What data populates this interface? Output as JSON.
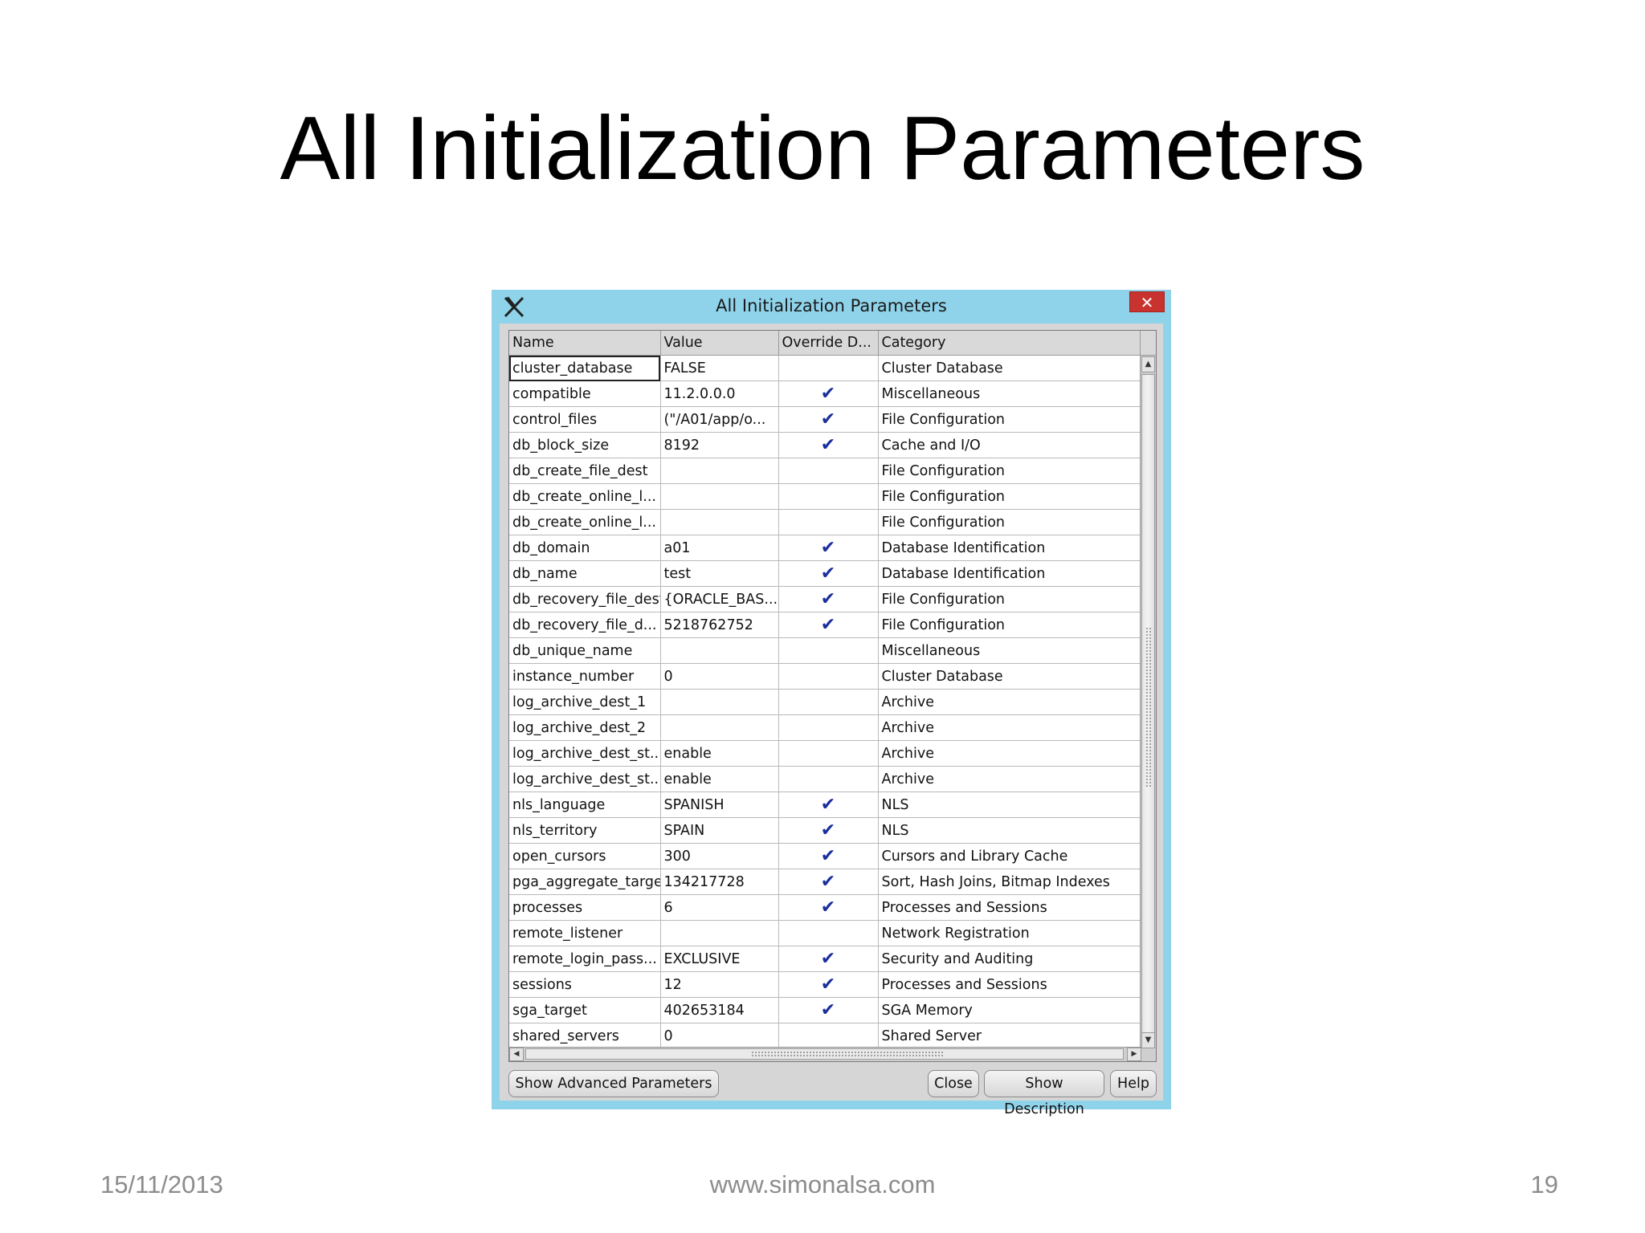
{
  "slide": {
    "title": "All Initialization Parameters",
    "footer": {
      "date": "15/11/2013",
      "site": "www.simonalsa.com",
      "page": "19"
    }
  },
  "window": {
    "title": "All Initialization Parameters",
    "close_glyph": "✕",
    "icon": "x-app-icon"
  },
  "table": {
    "columns": [
      "Name",
      "Value",
      "Override D...",
      "Category"
    ],
    "rows": [
      {
        "name": "cluster_database",
        "value": "FALSE",
        "override": "",
        "category": "Cluster Database"
      },
      {
        "name": "compatible",
        "value": "11.2.0.0.0",
        "override": "✔",
        "category": "Miscellaneous"
      },
      {
        "name": "control_files",
        "value": "(\"/A01/app/o...",
        "override": "✔",
        "category": "File Configuration"
      },
      {
        "name": "db_block_size",
        "value": "8192",
        "override": "✔",
        "category": "Cache and I/O"
      },
      {
        "name": "db_create_file_dest",
        "value": "",
        "override": "",
        "category": "File Configuration"
      },
      {
        "name": "db_create_online_l...",
        "value": "",
        "override": "",
        "category": "File Configuration"
      },
      {
        "name": "db_create_online_l...",
        "value": "",
        "override": "",
        "category": "File Configuration"
      },
      {
        "name": "db_domain",
        "value": "a01",
        "override": "✔",
        "category": "Database Identification"
      },
      {
        "name": "db_name",
        "value": "test",
        "override": "✔",
        "category": "Database Identification"
      },
      {
        "name": "db_recovery_file_dest",
        "value": "{ORACLE_BAS...",
        "override": "✔",
        "category": "File Configuration"
      },
      {
        "name": "db_recovery_file_d...",
        "value": "5218762752",
        "override": "✔",
        "category": "File Configuration"
      },
      {
        "name": "db_unique_name",
        "value": "",
        "override": "",
        "category": "Miscellaneous"
      },
      {
        "name": "instance_number",
        "value": "0",
        "override": "",
        "category": "Cluster Database"
      },
      {
        "name": "log_archive_dest_1",
        "value": "",
        "override": "",
        "category": "Archive"
      },
      {
        "name": "log_archive_dest_2",
        "value": "",
        "override": "",
        "category": "Archive"
      },
      {
        "name": "log_archive_dest_st...",
        "value": "enable",
        "override": "",
        "category": "Archive"
      },
      {
        "name": "log_archive_dest_st...",
        "value": "enable",
        "override": "",
        "category": "Archive"
      },
      {
        "name": "nls_language",
        "value": "SPANISH",
        "override": "✔",
        "category": "NLS"
      },
      {
        "name": "nls_territory",
        "value": "SPAIN",
        "override": "✔",
        "category": "NLS"
      },
      {
        "name": "open_cursors",
        "value": "300",
        "override": "✔",
        "category": "Cursors and Library Cache"
      },
      {
        "name": "pga_aggregate_target",
        "value": "134217728",
        "override": "✔",
        "category": "Sort, Hash Joins, Bitmap Indexes"
      },
      {
        "name": "processes",
        "value": "6",
        "override": "✔",
        "category": "Processes and Sessions"
      },
      {
        "name": "remote_listener",
        "value": "",
        "override": "",
        "category": "Network Registration"
      },
      {
        "name": "remote_login_pass...",
        "value": "EXCLUSIVE",
        "override": "✔",
        "category": "Security and Auditing"
      },
      {
        "name": "sessions",
        "value": "12",
        "override": "✔",
        "category": "Processes and Sessions"
      },
      {
        "name": "sga_target",
        "value": "402653184",
        "override": "✔",
        "category": "SGA Memory"
      },
      {
        "name": "shared_servers",
        "value": "0",
        "override": "",
        "category": "Shared Server"
      }
    ],
    "selected_row": 0
  },
  "buttons": {
    "advanced": "Show Advanced Parameters",
    "close": "Close",
    "description": "Show Description",
    "help": "Help"
  },
  "colors": {
    "window_frame": "#8fd3ea",
    "close_button": "#c9332f",
    "checkmark": "#1a2e9c"
  }
}
